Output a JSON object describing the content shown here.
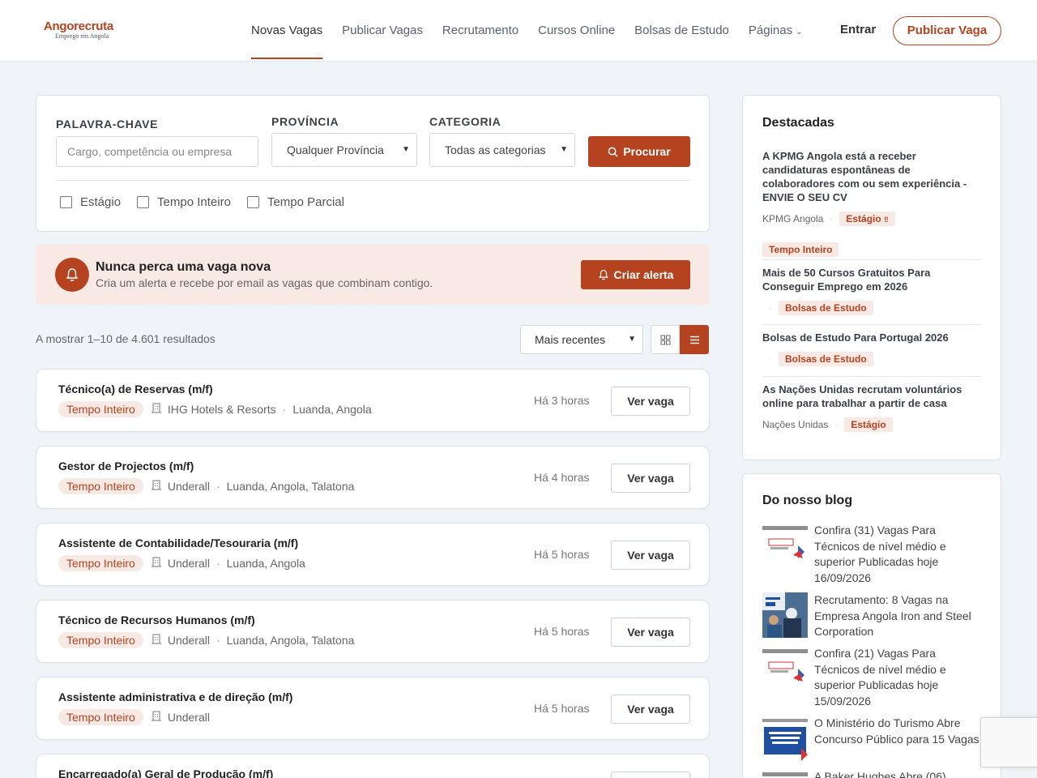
{
  "brand": {
    "name": "Angorecruta",
    "tagline": "Emprego em Angola",
    "accent": "#b5431f"
  },
  "nav": {
    "items": [
      "Novas Vagas",
      "Publicar Vagas",
      "Recrutamento",
      "Cursos Online",
      "Bolsas de Estudo",
      "Páginas"
    ],
    "active": "Novas Vagas",
    "login": "Entrar",
    "publish": "Publicar Vaga"
  },
  "search": {
    "keyword_label": "PALAVRA-CHAVE",
    "keyword_placeholder": "Cargo, competência ou empresa",
    "province_label": "PROVÍNCIA",
    "province_value": "Qualquer Província",
    "category_label": "CATEGORIA",
    "category_value": "Todas as categorias",
    "button": "Procurar",
    "checkboxes": [
      "Estágio",
      "Tempo Inteiro",
      "Tempo Parcial"
    ]
  },
  "alert": {
    "title": "Nunca perca uma vaga nova",
    "subtitle": "Cria um alerta e recebe por email as vagas que combinam contigo.",
    "button": "Criar alerta"
  },
  "results": {
    "count_text": "A mostrar 1–10 de 4.601 resultados",
    "sort": "Mais recentes"
  },
  "jobs": [
    {
      "title": "Técnico(a) de Reservas (m/f)",
      "type": "Tempo Inteiro",
      "company": "IHG Hotels & Resorts",
      "location": "Luanda, Angola",
      "time": "Há 3 horas",
      "button": "Ver vaga"
    },
    {
      "title": "Gestor de Projectos (m/f)",
      "type": "Tempo Inteiro",
      "company": "Underall",
      "location": "Luanda, Angola, Talatona",
      "time": "Há 4 horas",
      "button": "Ver vaga"
    },
    {
      "title": "Assistente de Contabilidade/Tesouraria (m/f)",
      "type": "Tempo Inteiro",
      "company": "Underall",
      "location": "Luanda, Angola",
      "time": "Há 5 horas",
      "button": "Ver vaga"
    },
    {
      "title": "Técnico de Recursos Humanos (m/f)",
      "type": "Tempo Inteiro",
      "company": "Underall",
      "location": "Luanda, Angola, Talatona",
      "time": "Há 5 horas",
      "button": "Ver vaga"
    },
    {
      "title": "Assistente administrativa e de direção (m/f)",
      "type": "Tempo Inteiro",
      "company": "Underall",
      "location": "",
      "time": "Há 5 horas",
      "button": "Ver vaga"
    },
    {
      "title": "Encarregado(a) Geral de Produção (m/f)",
      "type": "",
      "company": "",
      "location": "",
      "time": "",
      "button": ""
    }
  ],
  "featured": {
    "title": "Destacadas",
    "items": [
      {
        "title": "A KPMG Angola está a receber candidaturas espontâneas de colaboradores com ou sem experiência - ENVIE O SEU CV",
        "company": "KPMG Angola",
        "tags": [
          "Estágio",
          "Tempo Inteiro"
        ]
      },
      {
        "title": "Mais de 50 Cursos Gratuitos Para Conseguir Emprego em 2026",
        "company": "",
        "tags": [
          "Bolsas de Estudo"
        ]
      },
      {
        "title": "Bolsas de Estudo Para Portugal 2026",
        "company": "",
        "tags": [
          "Bolsas de Estudo"
        ]
      },
      {
        "title": "As Nações Unidas recrutam voluntários online para trabalhar a partir de casa",
        "company": "Nações Unidas",
        "tags": [
          "Estágio"
        ]
      }
    ]
  },
  "blog": {
    "title": "Do nosso blog",
    "items": [
      {
        "title": "Confira (31) Vagas Para Técnicos de nível médio e superior Publicadas hoje 16/09/2026",
        "thumb": "vagas-thumbnail"
      },
      {
        "title": "Recrutamento: 8 Vagas na Empresa Angola Iron and Steel Corporation",
        "thumb": "workers-thumbnail"
      },
      {
        "title": "Confira (21) Vagas Para Técnicos de nível médio e superior Publicadas hoje 15/09/2026",
        "thumb": "vagas-thumbnail"
      },
      {
        "title": "O Ministério do Turismo Abre Concurso Público para 15 Vagas",
        "thumb": "concurso-thumbnail"
      },
      {
        "title": "A Baker Hughes Abre (06)",
        "thumb": "vagas-thumbnail"
      }
    ]
  }
}
